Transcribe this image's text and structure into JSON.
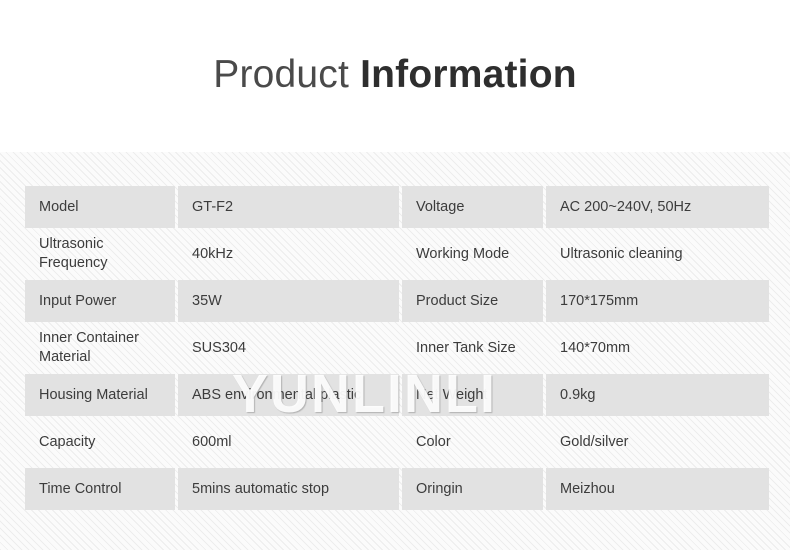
{
  "header": {
    "title_light": "Product ",
    "title_bold": "Information"
  },
  "watermark": {
    "text": "YUNLINLI"
  },
  "table": {
    "rows": [
      {
        "style": "filled",
        "label_a": "Model",
        "value_a": "GT-F2",
        "label_b": "Voltage",
        "value_b": "AC 200~240V, 50Hz"
      },
      {
        "style": "open",
        "label_a": "Ultrasonic Frequency",
        "value_a": "40kHz",
        "label_b": "Working Mode",
        "value_b": "Ultrasonic cleaning"
      },
      {
        "style": "filled",
        "label_a": "Input Power",
        "value_a": "35W",
        "label_b": "Product Size",
        "value_b": "170*175mm"
      },
      {
        "style": "open",
        "label_a": "Inner Container Material",
        "value_a": "SUS304",
        "label_b": "Inner Tank Size",
        "value_b": "140*70mm"
      },
      {
        "style": "filled",
        "label_a": "Housing Material",
        "value_a": "ABS environmental plastic",
        "label_b": "Net Weight",
        "value_b": "0.9kg"
      },
      {
        "style": "open",
        "label_a": "Capacity",
        "value_a": "600ml",
        "label_b": "Color",
        "value_b": "Gold/silver"
      },
      {
        "style": "filled",
        "label_a": "Time Control",
        "value_a": "5mins automatic stop",
        "label_b": "Oringin",
        "value_b": "Meizhou"
      }
    ]
  }
}
